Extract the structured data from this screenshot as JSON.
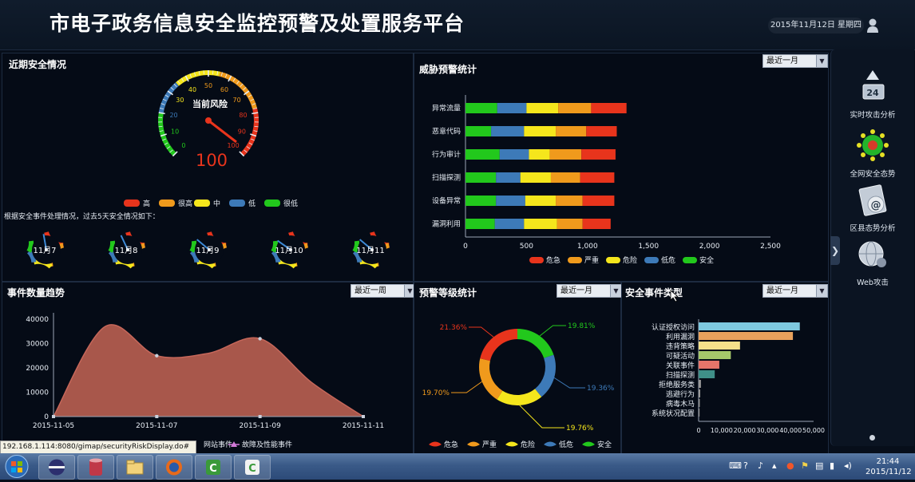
{
  "header": {
    "title": "市电子政务信息安全监控预警及处置服务平台",
    "date": "2015年11月12日 星期四"
  },
  "panels": {
    "recent": {
      "title": "近期安全情况",
      "gauge_label": "当前风险",
      "gauge_value": "100",
      "description": "根据安全事件处理情况，过去5天安全情况如下：",
      "gauge_ticks": [
        "0",
        "10",
        "20",
        "30",
        "40",
        "50",
        "60",
        "70",
        "80",
        "90",
        "100"
      ],
      "legend": [
        "高",
        "很高",
        "中",
        "低",
        "很低"
      ],
      "mini_gauges": [
        "11月7",
        "11月8",
        "11月9",
        "11月10",
        "11月11"
      ]
    },
    "threat": {
      "title": "威胁预警统计",
      "select": "最近一月"
    },
    "trend": {
      "title": "事件数量趋势",
      "select": "最近一周",
      "legend": [
        "网站事件",
        "故障及性能事件"
      ]
    },
    "level": {
      "title": "预警等级统计",
      "select": "最近一月"
    },
    "types": {
      "title": "安全事件类型",
      "select": "最近一月"
    }
  },
  "colors": {
    "red": "#e8341c",
    "orange": "#f09a1c",
    "yellow": "#f5e61c",
    "blue": "#3d7ab8",
    "green": "#22c81c"
  },
  "chart_data": [
    {
      "type": "bar",
      "orientation": "horizontal",
      "stacked": true,
      "categories": [
        "异常流量",
        "恶意代码",
        "行为审计",
        "扫描探测",
        "设备异常",
        "漏洞利用"
      ],
      "series": [
        {
          "name": "安全",
          "values": [
            260,
            210,
            280,
            250,
            250,
            240
          ]
        },
        {
          "name": "低危",
          "values": [
            240,
            270,
            240,
            200,
            240,
            240
          ]
        },
        {
          "name": "危险",
          "values": [
            260,
            260,
            170,
            250,
            250,
            270
          ]
        },
        {
          "name": "严重",
          "values": [
            270,
            250,
            260,
            240,
            220,
            210
          ]
        },
        {
          "name": "危急",
          "values": [
            290,
            250,
            280,
            280,
            260,
            230
          ]
        }
      ],
      "xlim": [
        0,
        2500
      ],
      "xticks": [
        "0",
        "500",
        "1,000",
        "1,500",
        "2,000",
        "2,500"
      ],
      "legend": "bottom"
    },
    {
      "type": "area",
      "x": [
        "2015-11-05",
        "2015-11-06",
        "2015-11-07",
        "2015-11-08",
        "2015-11-09",
        "2015-11-10",
        "2015-11-11"
      ],
      "values": [
        0,
        37000,
        25000,
        26000,
        32000,
        14000,
        0
      ],
      "ylim": [
        0,
        40000
      ],
      "yticks": [
        "0",
        "10000",
        "20000",
        "30000",
        "40000"
      ],
      "xticks": [
        "2015-11-05",
        "2015-11-07",
        "2015-11-09",
        "2015-11-11"
      ]
    },
    {
      "type": "pie",
      "donut": true,
      "labels": [
        "危急",
        "严重",
        "危险",
        "低危",
        "安全"
      ],
      "values": [
        21.36,
        19.7,
        19.76,
        19.36,
        19.81
      ],
      "value_labels": [
        "21.36%",
        "19.70%",
        "19.76%",
        "19.36%",
        "19.81%"
      ]
    },
    {
      "type": "bar",
      "orientation": "horizontal",
      "categories": [
        "认证授权访问",
        "利用漏洞",
        "违背策略",
        "可疑活动",
        "关联事件",
        "扫描探测",
        "拒绝服务类",
        "逃避行为",
        "病毒木马",
        "系统状况配置"
      ],
      "values": [
        44000,
        41000,
        18000,
        14000,
        9000,
        7000,
        1000,
        700,
        500,
        400
      ],
      "colors": [
        "#7ec8de",
        "#e8a15c",
        "#f6e08a",
        "#a6c76a",
        "#e6746a",
        "#3f8f88",
        "#999999",
        "#999999",
        "#999999",
        "#999999"
      ],
      "xlim": [
        0,
        50000
      ],
      "xticks": [
        "0",
        "10,000",
        "20,000",
        "30,000",
        "40,000",
        "50,000"
      ]
    }
  ],
  "right_nav": [
    {
      "label": "实时攻击分析",
      "icon": "attack-analysis-icon"
    },
    {
      "label": "全网安全态势",
      "icon": "network-situation-icon"
    },
    {
      "label": "区县态势分析",
      "icon": "district-analysis-icon"
    },
    {
      "label": "Web攻击",
      "icon": "web-attack-icon"
    }
  ],
  "status_url": "192.168.1.114:8080/gimap/securityRiskDisplay.do#",
  "clock": {
    "time": "21:44",
    "date": "2015/11/12"
  }
}
